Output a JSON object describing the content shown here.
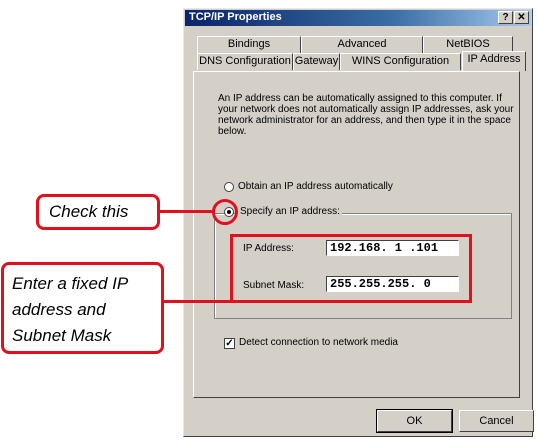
{
  "window": {
    "title": "TCP/IP Properties",
    "help_glyph": "?",
    "close_glyph": "✕"
  },
  "tabs_row1": [
    "Bindings",
    "Advanced",
    "NetBIOS"
  ],
  "tabs_row2": [
    "DNS Configuration",
    "Gateway",
    "WINS Configuration",
    "IP Address"
  ],
  "active_tab": "IP Address",
  "description": "An IP address can be automatically assigned to this computer. If your network does not automatically assign IP addresses, ask your network administrator for an address, and then type it in the space below.",
  "options": {
    "obtain_auto": {
      "label": "Obtain an IP address automatically",
      "selected": false
    },
    "specify": {
      "label": "Specify an IP address:",
      "selected": true
    }
  },
  "fields": {
    "ip_label": "IP Address:",
    "ip_value": "192.168. 1 .101",
    "mask_label": "Subnet Mask:",
    "mask_value": "255.255.255. 0"
  },
  "detect_media": {
    "label": "Detect connection to network media",
    "checked": true,
    "check_glyph": "✓"
  },
  "buttons": {
    "ok": "OK",
    "cancel": "Cancel"
  },
  "annotations": {
    "check_this": "Check this",
    "enter_fixed_line1": "Enter a fixed IP",
    "enter_fixed_line2": "address and",
    "enter_fixed_line3": "Subnet Mask"
  },
  "colors": {
    "annotation_red": "#e0101e",
    "titlebar": "#0a246a",
    "dialog_bg": "#d4d0c8"
  }
}
